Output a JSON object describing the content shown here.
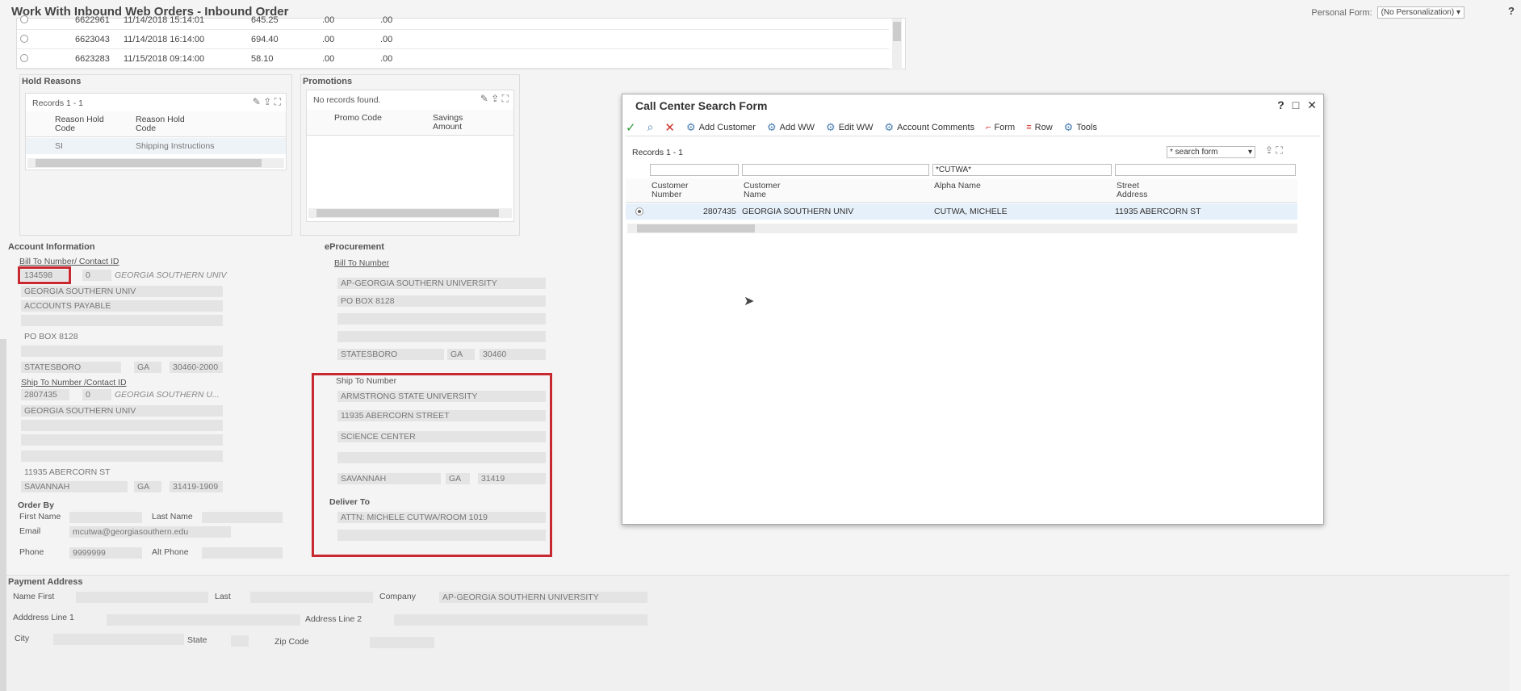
{
  "app": {
    "title": "Work With Inbound Web Orders - Inbound Order",
    "personal_form_label": "Personal Form:",
    "personal_form_value": "(No Personalization)"
  },
  "orders": [
    {
      "num": "6622961",
      "date": "11/14/2018 15:14:01",
      "amount": "645.25",
      "c1": ".00",
      "c2": ".00"
    },
    {
      "num": "6623043",
      "date": "11/14/2018 16:14:00",
      "amount": "694.40",
      "c1": ".00",
      "c2": ".00"
    },
    {
      "num": "6623283",
      "date": "11/15/2018 09:14:00",
      "amount": "58.10",
      "c1": ".00",
      "c2": ".00"
    }
  ],
  "hold_reasons": {
    "title": "Hold Reasons",
    "records": "Records 1 - 1",
    "col1": "Reason Hold Code",
    "col2": "Reason Hold Code",
    "row": {
      "code": "SI",
      "desc": "Shipping Instructions"
    }
  },
  "promotions": {
    "title": "Promotions",
    "no_records": "No records found.",
    "col1": "Promo Code",
    "col2": "Savings Amount"
  },
  "account": {
    "title": "Account Information",
    "bill_to_label": "Bill To Number/ Contact ID",
    "bill_to_number": "134598",
    "bill_contact": "0",
    "bill_name_italic": "GEORGIA SOUTHERN UNIV",
    "bill_lines": [
      "GEORGIA SOUTHERN UNIV",
      "ACCOUNTS PAYABLE",
      "",
      "PO BOX 8128",
      ""
    ],
    "bill_city": "STATESBORO",
    "bill_state": "GA",
    "bill_zip": "30460-2000",
    "ship_to_label": "Ship To Number /Contact ID",
    "ship_to_number": "2807435",
    "ship_contact": "0",
    "ship_name_italic": "GEORGIA SOUTHERN U...",
    "ship_lines": [
      "GEORGIA SOUTHERN UNIV",
      "",
      "",
      "",
      "11935 ABERCORN ST"
    ],
    "ship_city": "SAVANNAH",
    "ship_state": "GA",
    "ship_zip": "31419-1909"
  },
  "order_by": {
    "title": "Order By",
    "first_name_label": "First Name",
    "last_name_label": "Last Name",
    "email_label": "Email",
    "email_value": "mcutwa@georgiasouthern.edu",
    "phone_label": "Phone",
    "phone_value": "9999999",
    "alt_phone_label": "Alt Phone"
  },
  "eprocurement": {
    "title": "eProcurement",
    "bill_to_label": "Bill To Number",
    "bill_lines": [
      "AP-GEORGIA SOUTHERN UNIVERSITY",
      "PO BOX 8128",
      "",
      ""
    ],
    "bill_city": "STATESBORO",
    "bill_state": "GA",
    "bill_zip": "30460",
    "ship_to_label": "Ship To Number",
    "ship_lines": [
      "ARMSTRONG STATE UNIVERSITY",
      "11935 ABERCORN STREET",
      "SCIENCE CENTER",
      ""
    ],
    "ship_city": "SAVANNAH",
    "ship_state": "GA",
    "ship_zip": "31419",
    "deliver_to_label": "Deliver To",
    "deliver_lines": [
      "ATTN: MICHELE CUTWA/ROOM 1019",
      ""
    ]
  },
  "payment": {
    "title": "Payment Address",
    "name_first_label": "Name First",
    "last_label": "Last",
    "company_label": "Company",
    "company_value": "AP-GEORGIA SOUTHERN UNIVERSITY",
    "addr1_label": "Adddress Line 1",
    "addr2_label": "Address Line 2",
    "city_label": "City",
    "state_label": "State",
    "zip_label": "Zip Code"
  },
  "dialog": {
    "title": "Call Center Search Form",
    "toolbar": {
      "add_customer": "Add Customer",
      "add_ww": "Add WW",
      "edit_ww": "Edit WW",
      "account_comments": "Account Comments",
      "form": "Form",
      "row": "Row",
      "tools": "Tools"
    },
    "records": "Records 1 - 1",
    "search_form_select": "* search form",
    "filter_alpha": "*CUTWA*",
    "cols": [
      "Customer Number",
      "Customer Name",
      "Alpha Name",
      "Street Address"
    ],
    "row": {
      "number": "2807435",
      "name": "GEORGIA SOUTHERN UNIV",
      "alpha": "CUTWA, MICHELE",
      "street": "11935 ABERCORN ST"
    }
  },
  "colors": {
    "accent": "#c8282f",
    "check": "#2e9b3a",
    "cancel": "#d0322c",
    "gear": "#4a7fb3"
  }
}
